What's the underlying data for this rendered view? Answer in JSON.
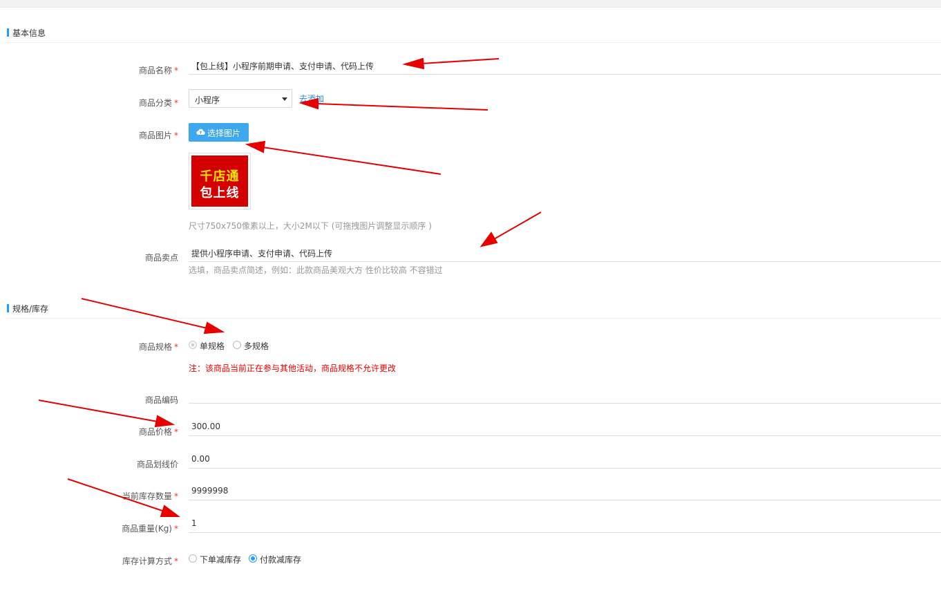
{
  "sections": {
    "basic": "基本信息",
    "spec_stock": "规格/库存"
  },
  "product_name": {
    "label": "商品名称",
    "required": "*",
    "value": "【包上线】小程序前期申请、支付申请、代码上传"
  },
  "category": {
    "label": "商品分类",
    "required": "*",
    "selected": "小程序",
    "add_link": "去添加"
  },
  "image": {
    "label": "商品图片",
    "required": "*",
    "button_icon": "cloud-upload-icon",
    "button_label": "选择图片",
    "thumb_line1": "千店通",
    "thumb_line2": "包上线",
    "hint": "尺寸750x750像素以上，大小2M以下 (可拖拽图片调整显示顺序 )"
  },
  "selling_point": {
    "label": "商品卖点",
    "value": "提供小程序申请、支付申请、代码上传",
    "hint": "选填，商品卖点简述，例如：此款商品美观大方 性价比较高 不容错过"
  },
  "spec": {
    "label": "商品规格",
    "required": "*",
    "options": [
      "单规格",
      "多规格"
    ],
    "selected": "单规格",
    "warning": "注：该商品当前正在参与其他活动，商品规格不允许更改"
  },
  "code": {
    "label": "商品编码",
    "value": ""
  },
  "price": {
    "label": "商品价格",
    "required": "*",
    "value": "300.00"
  },
  "line_price": {
    "label": "商品划线价",
    "value": "0.00"
  },
  "stock": {
    "label": "当前库存数量",
    "required": "*",
    "value": "9999998"
  },
  "weight": {
    "label": "商品重量(Kg)",
    "required": "*",
    "value": "1"
  },
  "stock_method": {
    "label": "库存计算方式",
    "required": "*",
    "options": [
      "下单减库存",
      "付款减库存"
    ],
    "selected": "付款减库存"
  },
  "colors": {
    "accent": "#1e9fff",
    "button": "#3ea8ef",
    "required": "#e33333",
    "warning": "#e60000",
    "annotation_arrow": "#e60000",
    "thumb_bg": "#d40000"
  }
}
